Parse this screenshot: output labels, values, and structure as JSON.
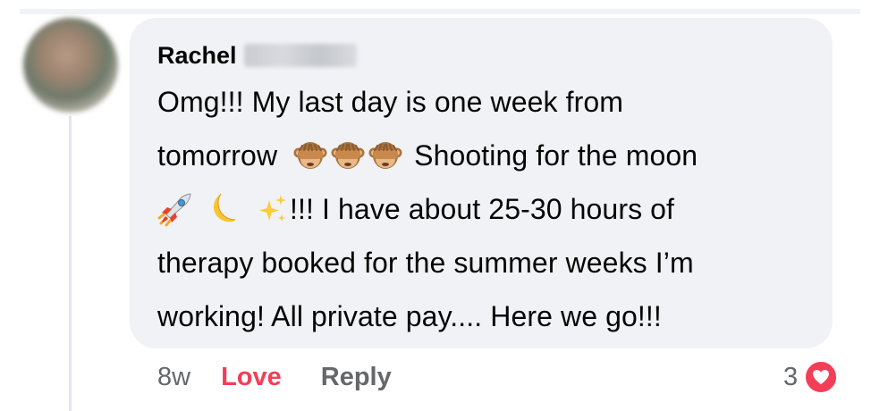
{
  "comment": {
    "author_name": "Rachel",
    "lines": {
      "l1": "Omg!!! My last day is one week from",
      "l2a": "tomorrow",
      "l2b": "Shooting for the moon",
      "l3": "!!! I have about 25-30 hours of",
      "l4": "therapy booked for the summer weeks I’m",
      "l5": "working! All private pay.... Here we go!!!"
    },
    "emojis": {
      "line2": [
        "see-no-evil-monkey",
        "see-no-evil-monkey",
        "see-no-evil-monkey"
      ],
      "line3": [
        "rocket",
        "crescent-moon",
        "sparkles"
      ]
    }
  },
  "footer": {
    "time": "8w",
    "love_label": "Love",
    "reply_label": "Reply"
  },
  "reactions": {
    "count": "3",
    "type": "heart",
    "color": "#f33e58"
  },
  "colors": {
    "bubble": "#f0f2f5",
    "text": "#050505",
    "muted": "#65676b",
    "love": "#f33e58"
  }
}
